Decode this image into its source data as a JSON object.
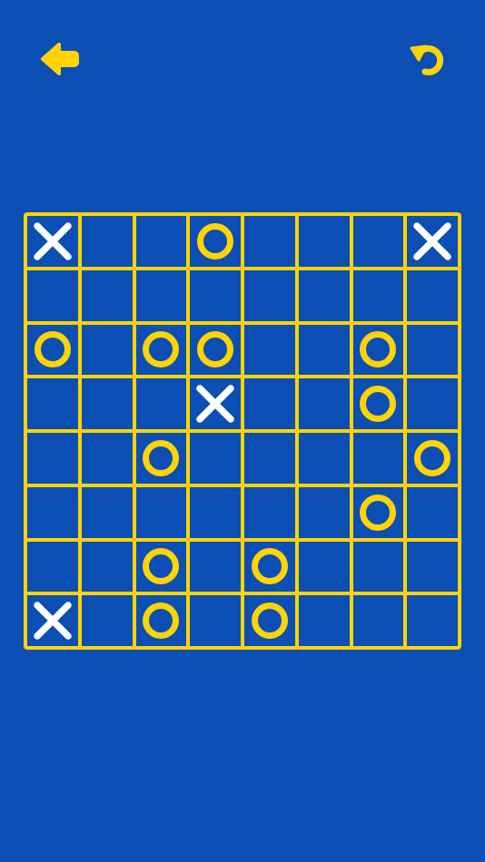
{
  "toolbar": {
    "back_icon": "arrow-left-icon",
    "undo_icon": "undo-icon"
  },
  "colors": {
    "background": "#0b4fb4",
    "grid": "#ffd400",
    "o_mark": "#ffd400",
    "x_mark": "#ffffff"
  },
  "board": {
    "size": 8,
    "rows": [
      [
        "X",
        "",
        "",
        "O",
        "",
        "",
        "",
        "X"
      ],
      [
        "",
        "",
        "",
        "",
        "",
        "",
        "",
        ""
      ],
      [
        "O",
        "",
        "O",
        "O",
        "",
        "",
        "O",
        ""
      ],
      [
        "",
        "",
        "",
        "X",
        "",
        "",
        "O",
        ""
      ],
      [
        "",
        "",
        "O",
        "",
        "",
        "",
        "",
        "O"
      ],
      [
        "",
        "",
        "",
        "",
        "",
        "",
        "O",
        ""
      ],
      [
        "",
        "",
        "O",
        "",
        "O",
        "",
        "",
        ""
      ],
      [
        "X",
        "",
        "O",
        "",
        "O",
        "",
        "",
        ""
      ]
    ]
  }
}
